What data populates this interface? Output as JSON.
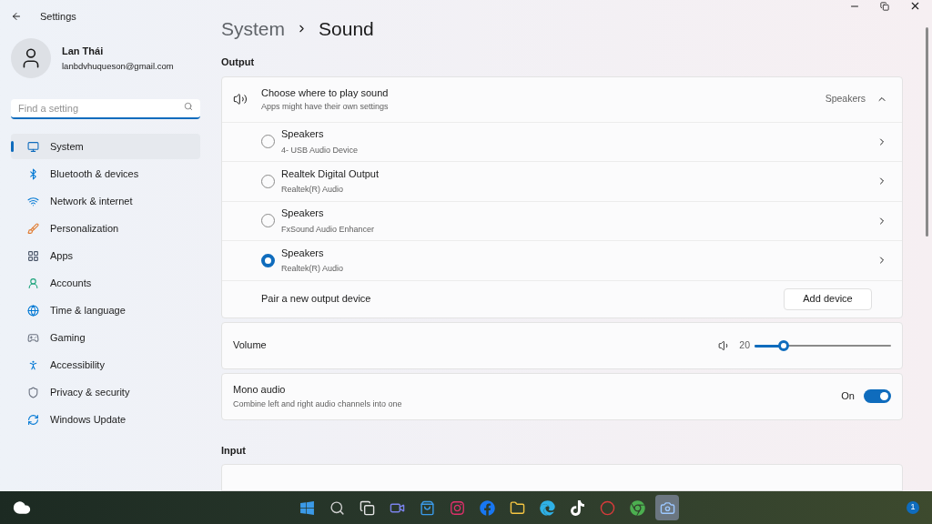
{
  "window": {
    "title": "Settings"
  },
  "user": {
    "name": "Lan Thái",
    "email": "lanbdvhuqueson@gmail.com"
  },
  "search": {
    "placeholder": "Find a setting"
  },
  "sidebar": {
    "items": [
      {
        "label": "System",
        "selected": true
      },
      {
        "label": "Bluetooth & devices",
        "selected": false
      },
      {
        "label": "Network & internet",
        "selected": false
      },
      {
        "label": "Personalization",
        "selected": false
      },
      {
        "label": "Apps",
        "selected": false
      },
      {
        "label": "Accounts",
        "selected": false
      },
      {
        "label": "Time & language",
        "selected": false
      },
      {
        "label": "Gaming",
        "selected": false
      },
      {
        "label": "Accessibility",
        "selected": false
      },
      {
        "label": "Privacy & security",
        "selected": false
      },
      {
        "label": "Windows Update",
        "selected": false
      }
    ]
  },
  "breadcrumb": [
    "System",
    "Sound"
  ],
  "output": {
    "heading": "Output",
    "chooser": {
      "title": "Choose where to play sound",
      "subtitle": "Apps might have their own settings",
      "value": "Speakers",
      "expanded": true
    },
    "devices": [
      {
        "name": "Speakers",
        "detail": "4- USB Audio Device",
        "selected": false
      },
      {
        "name": "Realtek Digital Output",
        "detail": "Realtek(R) Audio",
        "selected": false
      },
      {
        "name": "Speakers",
        "detail": "FxSound Audio Enhancer",
        "selected": false
      },
      {
        "name": "Speakers",
        "detail": "Realtek(R) Audio",
        "selected": true
      }
    ],
    "pair": {
      "label": "Pair a new output device",
      "button": "Add device"
    }
  },
  "volume": {
    "label": "Volume",
    "reading": "20",
    "level": 0.2
  },
  "mono": {
    "title": "Mono audio",
    "subtitle": "Combine left and right audio channels into one",
    "state_label": "On",
    "on": true
  },
  "input": {
    "heading": "Input"
  },
  "taskbar": {
    "apps": [
      {
        "selected": false
      },
      {
        "selected": false
      },
      {
        "selected": false
      },
      {
        "selected": false
      },
      {
        "selected": false
      },
      {
        "selected": false
      },
      {
        "selected": false
      },
      {
        "selected": false
      },
      {
        "selected": false
      },
      {
        "selected": false
      },
      {
        "selected": false
      },
      {
        "selected": false
      },
      {
        "selected": true
      }
    ],
    "badge": "1"
  }
}
